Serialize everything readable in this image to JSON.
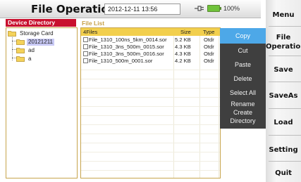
{
  "header": {
    "title": "File Operation",
    "datetime": "2012-12-11 13:56",
    "battery": "100%"
  },
  "directory": {
    "heading": "Device Directory",
    "items": [
      {
        "label": "Storage Card"
      },
      {
        "label": "20121211"
      },
      {
        "label": "ad"
      },
      {
        "label": "a"
      }
    ]
  },
  "file_list": {
    "heading": "File List",
    "columns": [
      "4Files",
      "Size",
      "Type"
    ],
    "rows": [
      {
        "name": "File_1310_100ns_5km_0014.sor",
        "size": "5.2 KB",
        "type": "Otdr"
      },
      {
        "name": "File_1310_3ns_500m_0015.sor",
        "size": "4.3 KB",
        "type": "Otdr"
      },
      {
        "name": "File_1310_3ns_500m_0016.sor",
        "size": "4.3 KB",
        "type": "Otdr"
      },
      {
        "name": "File_1310_500m_0001.sor",
        "size": "4.2 KB",
        "type": "Otdr"
      }
    ]
  },
  "context_menu": {
    "items": [
      {
        "label": "Copy"
      },
      {
        "label": "Cut"
      },
      {
        "label": "Paste"
      },
      {
        "label": "Delete"
      },
      {
        "label": "Select All"
      },
      {
        "label": "Rename"
      },
      {
        "label": "Create"
      },
      {
        "label": "Directory"
      }
    ]
  },
  "side_menu": {
    "items": [
      {
        "label": "Menu"
      },
      {
        "label": "File"
      },
      {
        "label": "Operation"
      },
      {
        "label": "Save"
      },
      {
        "label": "SaveAs"
      },
      {
        "label": "Load"
      },
      {
        "label": "Setting"
      },
      {
        "label": "Quit"
      }
    ]
  },
  "colors": {
    "accent_red": "#c8102e",
    "list_header_yellow": "#f2cf4d",
    "menu_active_blue": "#4da8e8",
    "menu_bg": "#3f3f3f"
  },
  "icons": [
    "plug-icon",
    "battery-icon",
    "folder-icon"
  ]
}
